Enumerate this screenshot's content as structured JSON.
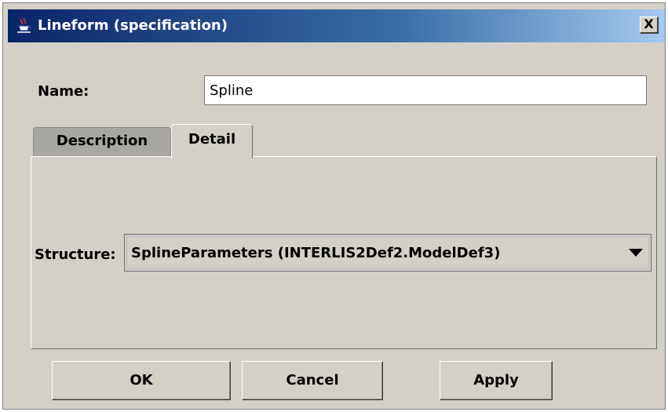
{
  "window": {
    "title": "Lineform (specification)",
    "icon": "java-cup-icon",
    "close_label": "X"
  },
  "name_field": {
    "label": "Name:",
    "value": "Spline"
  },
  "tabs": [
    {
      "label": "Description",
      "selected": false
    },
    {
      "label": "Detail",
      "selected": true
    }
  ],
  "detail": {
    "structure_label": "Structure:",
    "structure_value": "SplineParameters (INTERLIS2Def2.ModelDef3)"
  },
  "buttons": {
    "ok": "OK",
    "cancel": "Cancel",
    "apply": "Apply"
  },
  "colors": {
    "title_gradient_start": "#0a246a",
    "title_gradient_end": "#a6caf0",
    "dialog_bg": "#d4d0c8"
  }
}
